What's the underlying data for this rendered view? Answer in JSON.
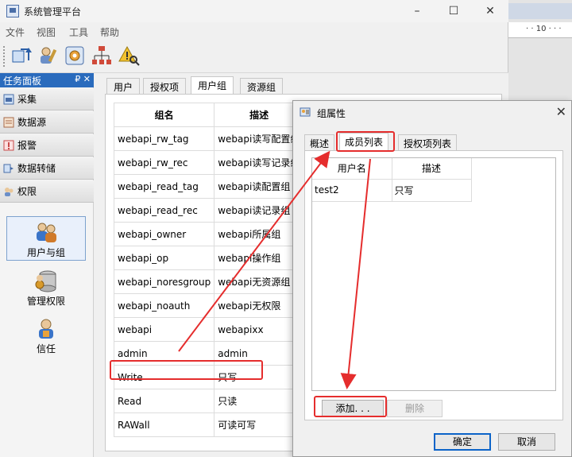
{
  "app": {
    "title": "系统管理平台",
    "window_buttons": [
      "–",
      "☐",
      "✕"
    ]
  },
  "menu": [
    "文件",
    "视图",
    "工具",
    "帮助"
  ],
  "toolbar": {
    "icons": [
      "connect-icon",
      "user-edit-icon",
      "settings-icon",
      "network-icon",
      "alert-search-icon"
    ]
  },
  "task_panel": {
    "title": "任务面板",
    "controls": "₽ ✕",
    "nav": [
      "采集",
      "数据源",
      "报警",
      "数据转储",
      "权限"
    ],
    "big_buttons": [
      "用户与组",
      "管理权限",
      "信任"
    ]
  },
  "main_tabs": [
    "用户",
    "授权项",
    "用户组",
    "资源组"
  ],
  "group_table": {
    "headers": [
      "组名",
      "描述"
    ],
    "rows": [
      [
        "webapi_rw_tag",
        "webapi读写配置组"
      ],
      [
        "webapi_rw_rec",
        "webapi读写记录组"
      ],
      [
        "webapi_read_tag",
        "webapi读配置组"
      ],
      [
        "webapi_read_rec",
        "webapi读记录组"
      ],
      [
        "webapi_owner",
        "webapi所属组"
      ],
      [
        "webapi_op",
        "webapi操作组"
      ],
      [
        "webapi_noresgroup",
        "webapi无资源组"
      ],
      [
        "webapi_noauth",
        "webapi无权限"
      ],
      [
        "webapi",
        "webapixx"
      ],
      [
        "admin",
        "admin"
      ],
      [
        "Write",
        "只写"
      ],
      [
        "Read",
        "只读"
      ],
      [
        "RAWall",
        "可读可写"
      ]
    ]
  },
  "bg_ruler": "· · 10 · · ·",
  "dialog": {
    "title": "组属性",
    "close": "✕",
    "tabs": [
      "概述",
      "成员列表",
      "授权项列表"
    ],
    "member_headers": [
      "用户名",
      "描述"
    ],
    "members": [
      [
        "test2",
        "只写"
      ]
    ],
    "add_label": "添加. . .",
    "delete_label": "删除",
    "ok_label": "确定",
    "cancel_label": "取消"
  },
  "colors": {
    "annotation": "#e52d2d",
    "panel_header": "#2a6bbd",
    "ok_border": "#0b63c8"
  }
}
